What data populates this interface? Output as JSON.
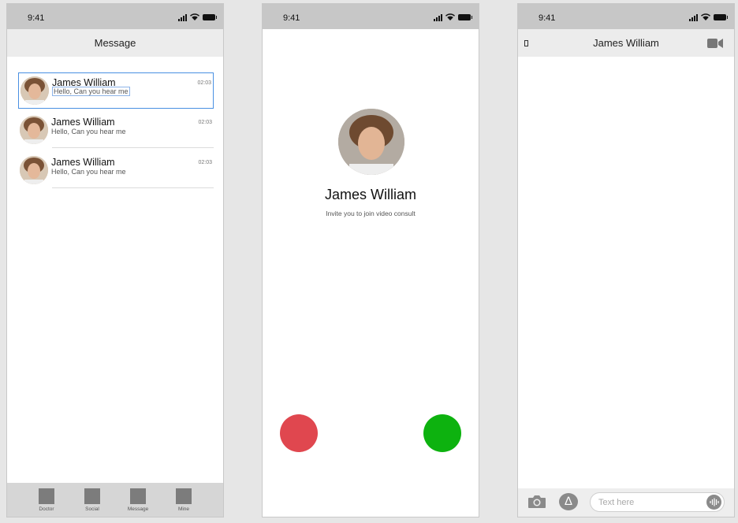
{
  "status_time": "9:41",
  "messages_screen": {
    "title": "Message",
    "items": [
      {
        "name": "James William",
        "preview": "Hello, Can you hear me",
        "time": "02:03"
      },
      {
        "name": "James William",
        "preview": "Hello, Can you hear me",
        "time": "02:03"
      },
      {
        "name": "James William",
        "preview": "Hello, Can you hear me",
        "time": "02:03"
      }
    ],
    "tabs": [
      {
        "label": "Doctor"
      },
      {
        "label": "Social"
      },
      {
        "label": "Message"
      },
      {
        "label": "Mine"
      }
    ]
  },
  "call_screen": {
    "caller_name": "James William",
    "subtitle": "Invite you to join video consult",
    "decline_color": "#e0474f",
    "accept_color": "#0db20f"
  },
  "chat_screen": {
    "title": "James William",
    "input_placeholder": "Text here"
  },
  "icons": [
    "signal-icon",
    "wifi-icon",
    "battery-icon",
    "back-icon",
    "video-camera-icon",
    "camera-icon",
    "app-store-icon",
    "audio-wave-icon"
  ]
}
